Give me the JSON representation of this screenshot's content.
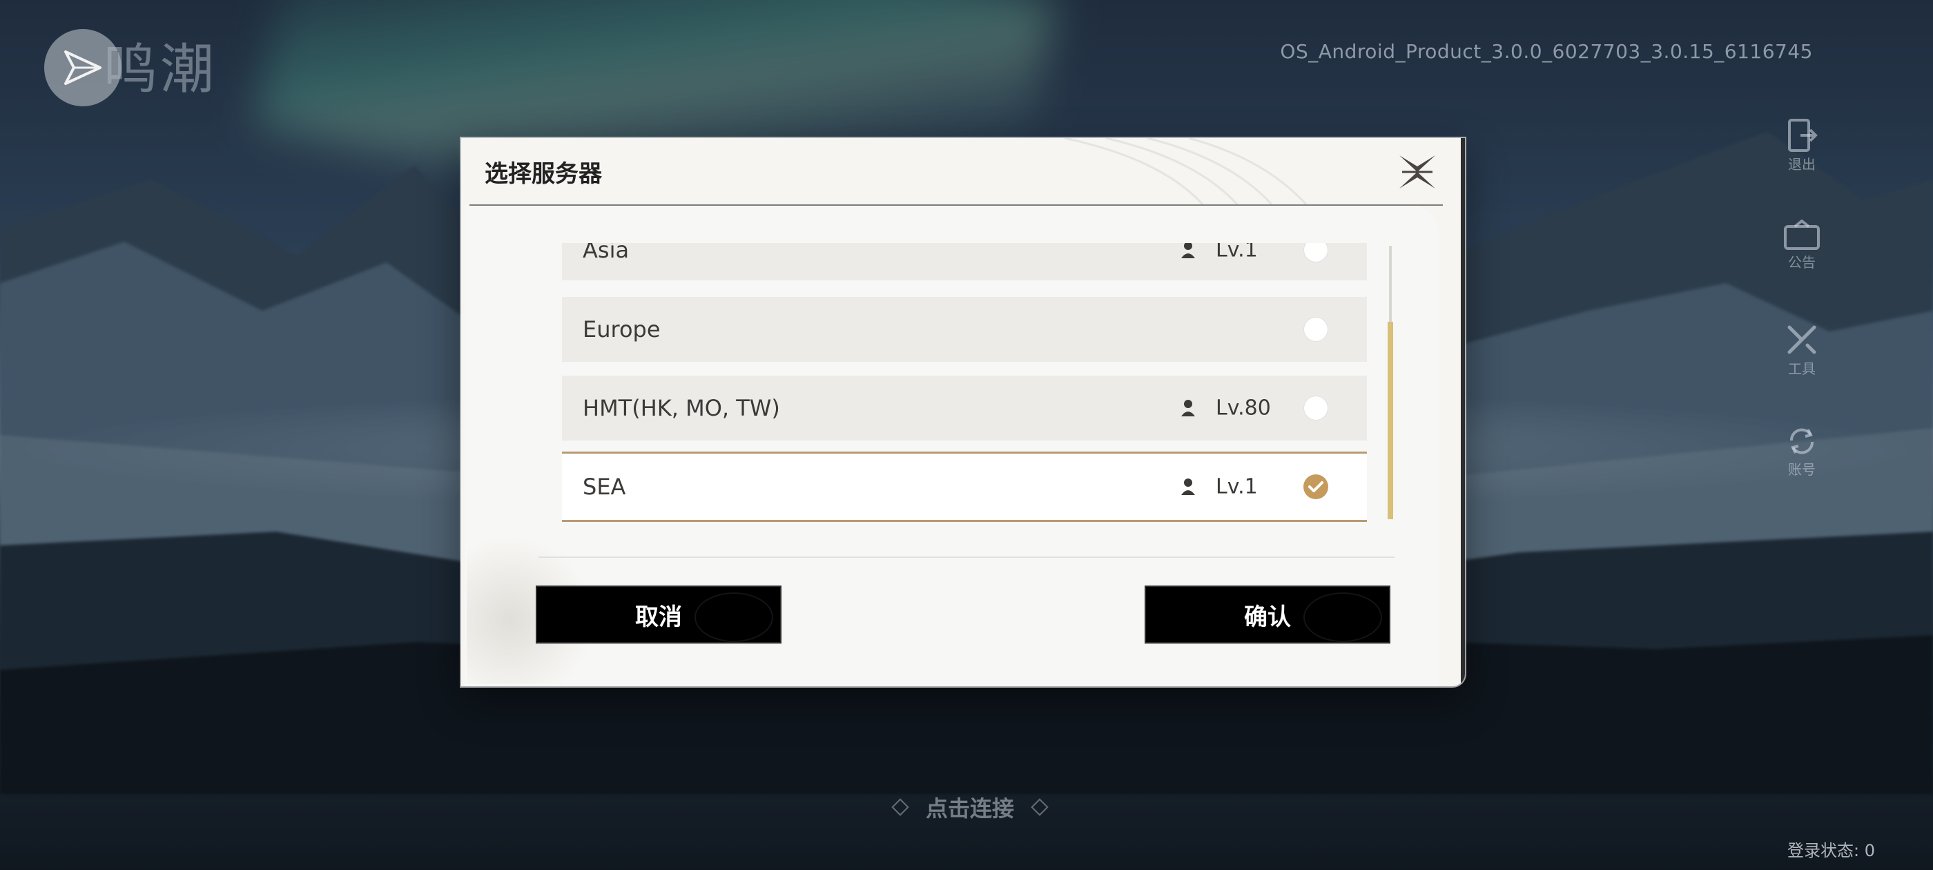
{
  "game": {
    "logo_text": "鸣潮",
    "version": "OS_Android_Product_3.0.0_6027703_3.0.15_6116745"
  },
  "side_menu": [
    {
      "label": "退出",
      "icon": "logout-icon"
    },
    {
      "label": "公告",
      "icon": "notice-icon"
    },
    {
      "label": "工具",
      "icon": "tools-icon"
    },
    {
      "label": "账号",
      "icon": "switch-account-icon"
    }
  ],
  "bottom": {
    "connect_label": "点击连接",
    "login_status": "登录状态: 0"
  },
  "dialog": {
    "title": "选择服务器",
    "close_icon": "close-icon",
    "servers": [
      {
        "name": "Asia",
        "level": "Lv.1",
        "selected": false
      },
      {
        "name": "Europe",
        "level": "",
        "selected": false
      },
      {
        "name": "HMT(HK, MO, TW)",
        "level": "Lv.80",
        "selected": false
      },
      {
        "name": "SEA",
        "level": "Lv.1",
        "selected": true
      }
    ],
    "scroll_position": 0.45,
    "cancel_label": "取消",
    "confirm_label": "确认"
  },
  "colors": {
    "accent_gold": "#c59a5a",
    "selected_border": "#b89b74",
    "scroll_thumb": "#d8c07a",
    "button_bg": "#000000",
    "row_bg": "#ecebe8"
  }
}
